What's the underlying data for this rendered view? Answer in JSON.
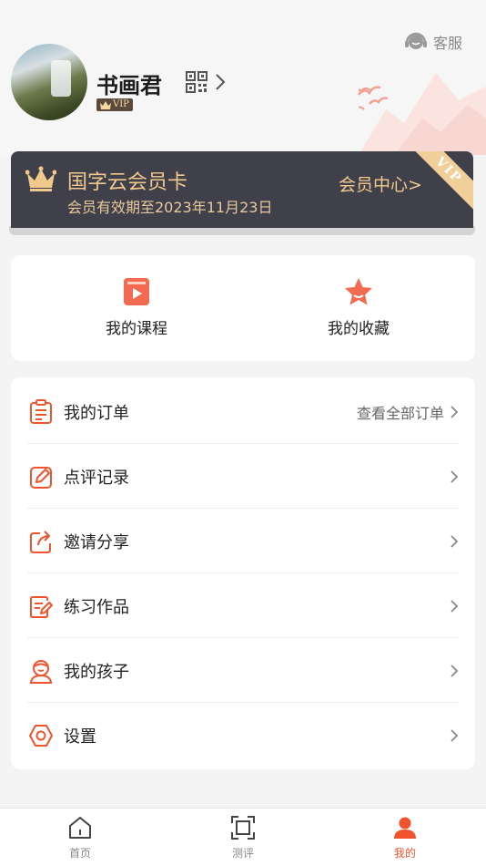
{
  "header": {
    "service_label": "客服",
    "username": "书画君",
    "vip_badge": "VIP"
  },
  "member_card": {
    "title": "国字云会员卡",
    "expiry": "会员有效期至2023年11月23日",
    "center_link": "会员中心>",
    "ribbon": "VIP",
    "accent_color": "#f2c98d"
  },
  "quick_links": [
    {
      "label": "我的课程",
      "icon": "play-video-icon"
    },
    {
      "label": "我的收藏",
      "icon": "star-icon"
    }
  ],
  "menu": [
    {
      "label": "我的订单",
      "extra": "查看全部订单",
      "icon": "order-clipboard-icon"
    },
    {
      "label": "点评记录",
      "extra": "",
      "icon": "edit-review-icon"
    },
    {
      "label": "邀请分享",
      "extra": "",
      "icon": "share-icon"
    },
    {
      "label": "练习作品",
      "extra": "",
      "icon": "practice-works-icon"
    },
    {
      "label": "我的孩子",
      "extra": "",
      "icon": "child-icon"
    },
    {
      "label": "设置",
      "extra": "",
      "icon": "settings-hexagon-icon"
    }
  ],
  "tabbar": [
    {
      "label": "首页",
      "icon": "home-icon",
      "active": false
    },
    {
      "label": "测评",
      "icon": "scan-frame-icon",
      "active": false
    },
    {
      "label": "我的",
      "icon": "profile-icon",
      "active": true
    }
  ],
  "colors": {
    "accent": "#f1542d",
    "card_bg": "#40404a",
    "gold": "#f2c98d"
  }
}
